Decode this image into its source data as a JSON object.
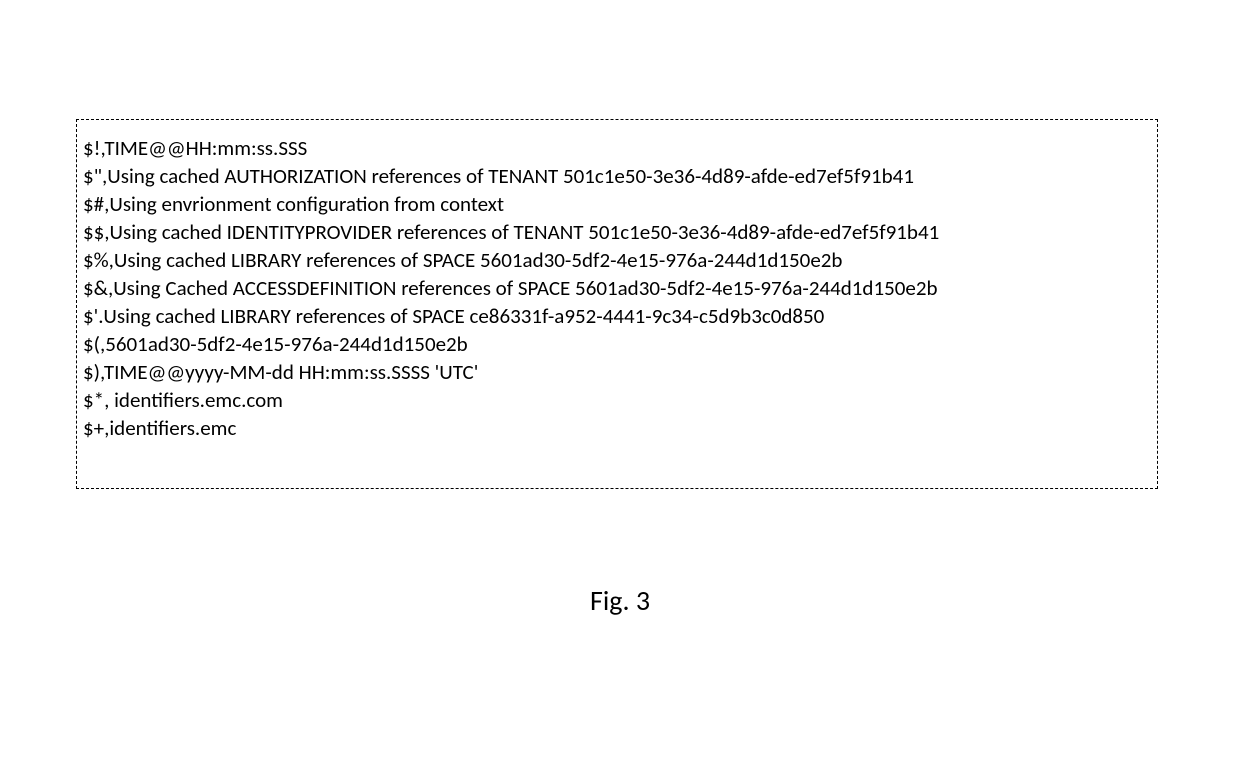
{
  "lines": [
    "$!,TIME@@HH:mm:ss.SSS",
    "$\",Using cached AUTHORIZATION references of TENANT 501c1e50-3e36-4d89-afde-ed7ef5f91b41",
    "$#,Using envrionment configuration from context",
    "$$,Using cached IDENTITYPROVIDER references of TENANT 501c1e50-3e36-4d89-afde-ed7ef5f91b41",
    "$%,Using cached LIBRARY references of SPACE 5601ad30-5df2-4e15-976a-244d1d150e2b",
    "$&,Using Cached ACCESSDEFINITION references of SPACE 5601ad30-5df2-4e15-976a-244d1d150e2b",
    "$'.Using cached LIBRARY references of SPACE ce86331f-a952-4441-9c34-c5d9b3c0d850",
    "$(,5601ad30-5df2-4e15-976a-244d1d150e2b",
    "$),TIME@@yyyy-MM-dd HH:mm:ss.SSSS 'UTC'",
    "$*, identifiers.emc.com",
    "$+,identifiers.emc"
  ],
  "figure_label": "Fig. 3"
}
